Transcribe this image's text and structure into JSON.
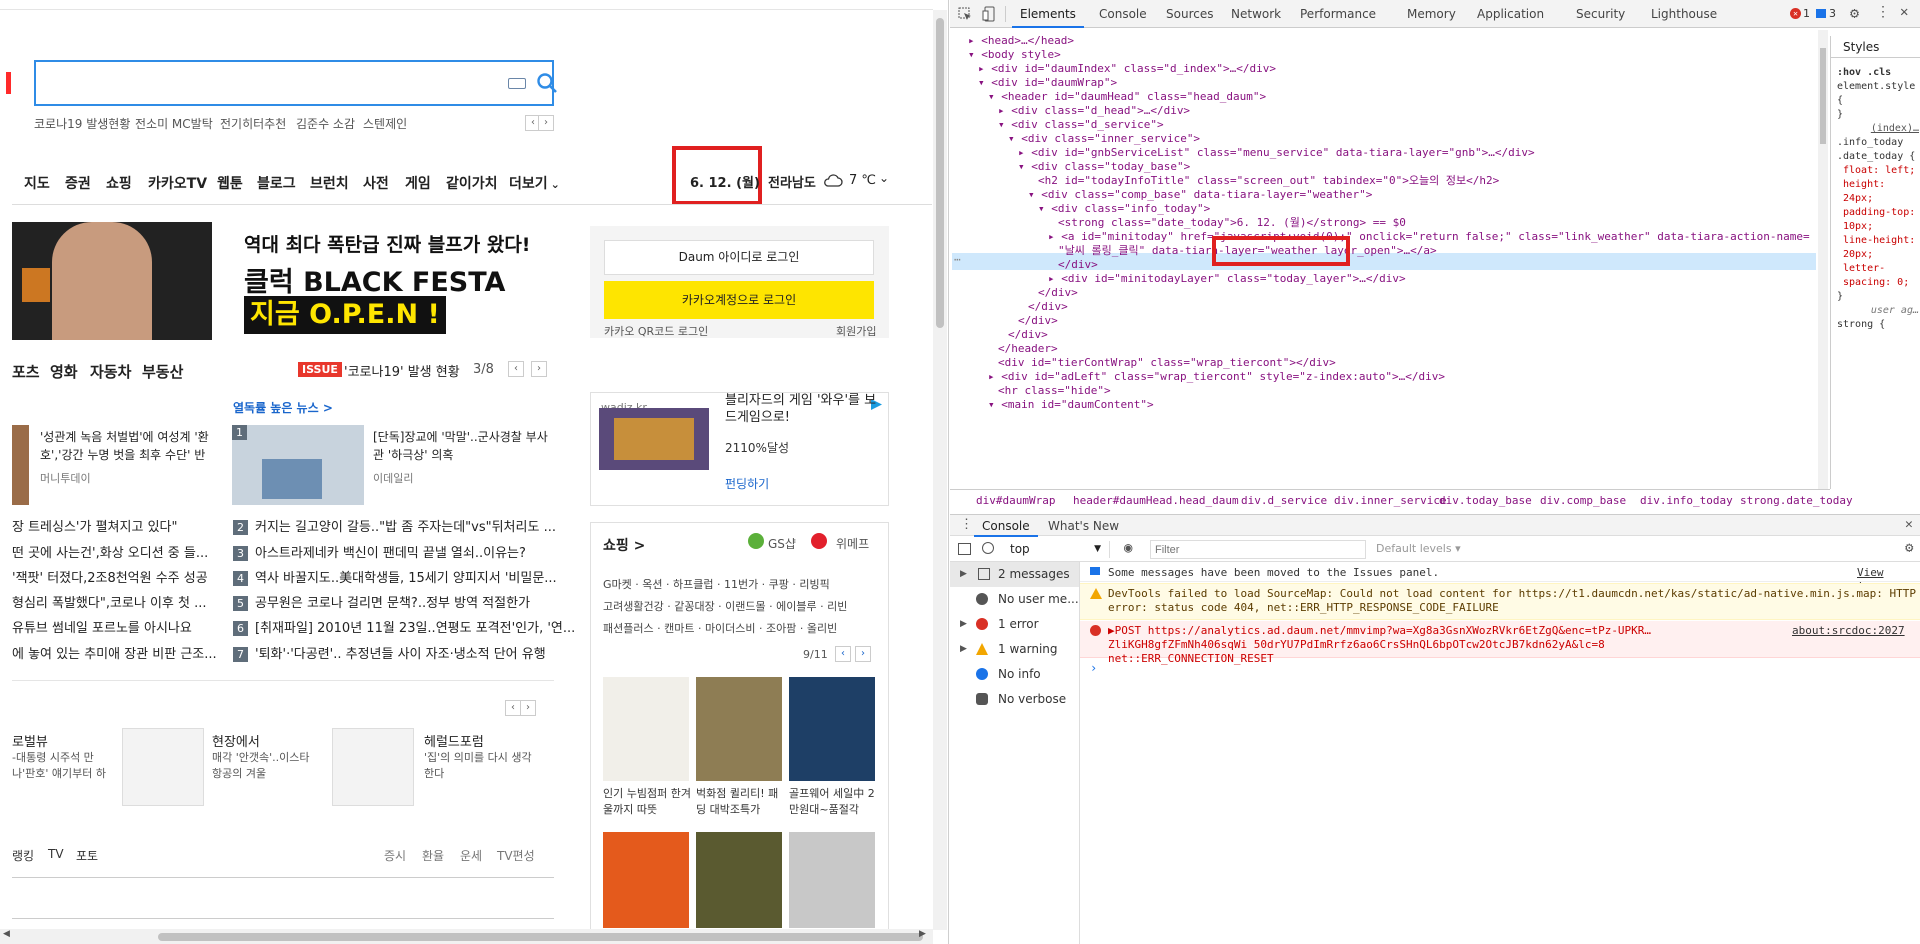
{
  "page": {
    "search": {
      "placeholder": ""
    },
    "hot_keywords": [
      "코로나19 발생현황",
      "전소미 MC발탁",
      "전기히터추천",
      "김준수 소감",
      "스텐제인"
    ],
    "nav": [
      "지도",
      "증권",
      "쇼핑",
      "카카오TV",
      "웹툰",
      "블로그",
      "브런치",
      "사전",
      "게임",
      "같이가치",
      "더보기"
    ],
    "date": "6. 12. (월)",
    "region": "전라남도",
    "temperature": "7 ℃",
    "banner": {
      "line1": "역대 최다 폭탄급 진짜 블프가 왔다!",
      "line2": "클럭 BLACK FESTA",
      "line3": "지금 O.P.E.N !"
    },
    "login": {
      "daum": "Daum 아이디로 로그인",
      "kakao": "카카오계정으로 로그인",
      "qr": "카카오 QR코드 로그인",
      "join": "회원가입"
    },
    "tabs": [
      "포츠",
      "영화",
      "자동차",
      "부동산"
    ],
    "issue": {
      "badge": "ISSUE",
      "text": "'코로나19' 발생 현황",
      "count": "3/8"
    },
    "popular_link": "열독률 높은 뉴스 >",
    "headline_left": {
      "title": "'성관계 녹음 처벌법'에 여성계 '환호','강간 누명 벗을 최후 수단' 반",
      "source": "머니투데이"
    },
    "headline_right": {
      "num": "1",
      "title": "[단독]장교에 '막말'..군사경찰 부사관 '하극상' 의혹",
      "source": "이데일리"
    },
    "news_left": [
      "장 트레싱스'가 펼쳐지고 있다\"",
      "떤 곳에 사는건',화상 오디션 중 들...",
      "'잭팟' 터졌다,2조8천억원 수주 성공",
      "형심리 폭발했다\",코로나 이후 첫 ...",
      "유튜브 썸네일 포르노를 아시나요",
      "에 놓여 있는 추미애 장관 비판 근조..."
    ],
    "news_right": [
      {
        "num": "2",
        "title": "커지는 길고양이 갈등..\"밥 좀 주자는데\"vs\"뒤처리도 ..."
      },
      {
        "num": "3",
        "title": "아스트라제네카 백신이 팬데믹 끝낼 열쇠..이유는?"
      },
      {
        "num": "4",
        "title": "역사 바꿀지도..美대학생들, 15세기 양피지서 '비밀문..."
      },
      {
        "num": "5",
        "title": "공무원은 코로나 걸리면 문책?..정부 방역 적절한가"
      },
      {
        "num": "6",
        "title": "[취재파일] 2010년 11월 23일..연평도 포격전'인가, '연..."
      },
      {
        "num": "7",
        "title": "'퇴화'·'다공련'.. 추정년들 사이 자조·냉소적 단어 유행"
      }
    ],
    "columns": [
      {
        "name": "로벌뷰",
        "text": "-대통령 시주석 만나'판호' 얘기부터 하"
      },
      {
        "name": "현장에서",
        "text": "매각 '안갯속'..이스타항공의 겨울"
      },
      {
        "name": "헤럴드포럼",
        "text": "'집'의 의미를 다시 생각한다"
      }
    ],
    "footer_tabs": [
      "랭킹",
      "TV",
      "포토"
    ],
    "footer_links": [
      "증시",
      "환율",
      "운세",
      "TV편성"
    ],
    "ad": {
      "source": "wadiz.kr",
      "title": "블리자드의 게임 '와우'를 보드게임으로!",
      "rate": "2110%달성",
      "cta": "펀딩하기"
    },
    "shopping": {
      "title": "쇼핑 >",
      "partner1": "GS샵",
      "partner2": "위메프",
      "links1": "G마켓 · 옥션 · 하프클럽 · 11번가 · 쿠팡 · 리빙픽",
      "links2": "고려생활건강 · 같꽁대장 · 이랜드몰 · 에이블루 · 리빈",
      "links3": "패션플러스 · 캔마트 · 마이더스비 · 조아팜 · 올리빈",
      "page": "9/11",
      "items": [
        {
          "title": "인기 누빔점퍼 한겨울까지 따뜻"
        },
        {
          "title": "벅화점 퀼리티! 패딩 대박조특가"
        },
        {
          "title": "골프웨어 세일中 2만원대~품절각"
        }
      ]
    }
  },
  "devtools": {
    "tabs": [
      "Elements",
      "Console",
      "Sources",
      "Network",
      "Performance",
      "Memory",
      "Application",
      "Security",
      "Lighthouse"
    ],
    "errors": "1",
    "issues": "3",
    "dom": [
      "<head>…</head>",
      "<body style>",
      "<div id=\"daumIndex\" class=\"d_index\">…</div>",
      "<div id=\"daumWrap\">",
      "<header id=\"daumHead\" class=\"head_daum\">",
      "<div class=\"d_head\">…</div>",
      "<div class=\"d_service\">",
      "<div class=\"inner_service\">",
      "<div id=\"gnbServiceList\" class=\"menu_service\" data-tiara-layer=\"gnb\">…</div>",
      "<div class=\"today_base\">",
      "<h2 id=\"todayInfoTitle\" class=\"screen_out\" tabindex=\"0\">오늘의 정보</h2>",
      "<div class=\"comp_base\" data-tiara-layer=\"weather\">",
      "<div class=\"info_today\">",
      "<strong class=\"date_today\">6. 12. (월)</strong> == $0",
      "<a id=\"minitoday\" href=\"javascript:void(0);\" onclick=\"return false;\" class=\"link_weather\" data-tiara-action-name=",
      "\"날씨 롤링_클릭\" data-tiara-layer=\"weather layer_open\">…</a>",
      "</div>",
      "<div id=\"minitodayLayer\" class=\"today_layer\">…</div>",
      "</div>",
      "</div>",
      "</div>",
      "</div>",
      "</header>",
      "<div id=\"tierContWrap\" class=\"wrap_tiercont\"></div>",
      "<div id=\"adLeft\" class=\"wrap_tiercont\" style=\"z-index:auto\">…</div>",
      "<hr class=\"hide\">",
      "<main id=\"daumContent\">"
    ],
    "styles_tab": "Styles",
    "styles_text": [
      ":hov .cls",
      "element.style {",
      "}",
      "(index)…",
      ".info_today .date_today {",
      "float: left;",
      "height: 24px;",
      "padding-top: 10px;",
      "line-height: 20px;",
      "letter-spacing: 0;",
      "}",
      "user ag…",
      "strong {"
    ],
    "breadcrumbs": [
      "div#daumWrap",
      "header#daumHead.head_daum",
      "div.d_service",
      "div.inner_service",
      "div.today_base",
      "div.comp_base",
      "div.info_today",
      "strong.date_today"
    ],
    "console_tabs": [
      "Console",
      "What's New"
    ],
    "context": "top",
    "filter_placeholder": "Filter",
    "levels": "Default levels",
    "sidebar": [
      "2 messages",
      "No user me...",
      "1 error",
      "1 warning",
      "No info",
      "No verbose"
    ],
    "messages": [
      {
        "type": "info",
        "text": "Some messages have been moved to the Issues panel.",
        "link": "View issues"
      },
      {
        "type": "warning",
        "text": "DevTools failed to load SourceMap: Could not load content for https://t1.daumcdn.net/kas/static/ad-native.min.js.map: HTTP error: status code 404, net::ERR_HTTP_RESPONSE_CODE_FAILURE"
      },
      {
        "type": "error",
        "text": "▶POST https://analytics.ad.daum.net/mmvimp?wa=Xg8a3GsnXWozRVkr6EtZgQ&enc=tPz-UPKR…ZliKGH8gfZFmNh406sqWi 50drYU7PdImRrfz6ao6CrsSHnQL6bpOTcw2OtcJB7kdn62yA&lc=8 net::ERR_CONNECTION_RESET",
        "link": "about:srcdoc:2027"
      }
    ]
  }
}
